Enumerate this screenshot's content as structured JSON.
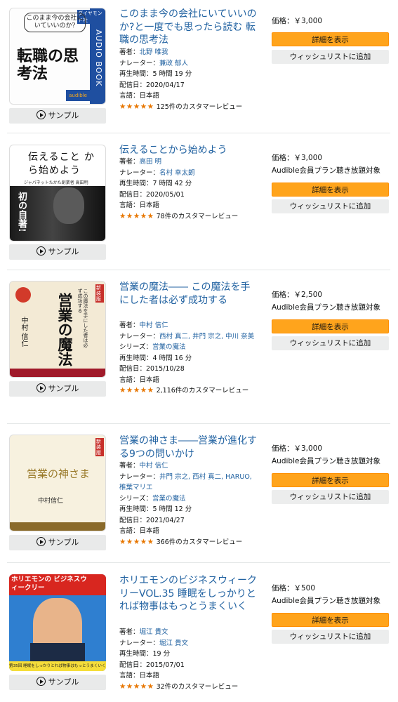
{
  "common": {
    "sample_label": "サンプル",
    "detail_label": "詳細を表示",
    "wishlist_label": "ウィッシュリストに追加",
    "author_prefix": "著者：",
    "narrator_prefix": "ナレーター：",
    "series_prefix": "シリーズ：",
    "runtime_prefix": "再生時間：",
    "release_prefix": "配信日：",
    "language_prefix": "言語：",
    "price_prefix": "価格：",
    "star_glyphs": "★★★★★",
    "star_color": "#e77600",
    "link_color": "#2162a1",
    "button_color": "#ffa41c"
  },
  "items": [
    {
      "title": "このまま今の会社にいていいのか?と一度でも思ったら読む 転職の思考法",
      "author": "北野 唯我",
      "narrator": "兼政 郁人",
      "runtime": "5 時間 19 分",
      "release": "2020/04/17",
      "language": "日本語",
      "rating": 4.5,
      "reviews": "125件のカスタマーレビュー",
      "price": "￥3,000",
      "membership": "",
      "cover": {
        "top_text": "このまま今の会社にいていいのか?",
        "main_text": "転職の思考法",
        "side_text": "AUDIO BOOK",
        "publisher": "ダイヤモンド社",
        "badge": "audible"
      }
    },
    {
      "title": "伝えることから始めよう",
      "author": "高田 明",
      "narrator": "名村 幸太朗",
      "runtime": "7 時間 42 分",
      "release": "2020/05/01",
      "language": "日本語",
      "rating": 4.5,
      "reviews": "78件のカスタマーレビュー",
      "price": "￥3,000",
      "membership": "Audible会員プラン聴き放題対象",
      "cover": {
        "top_text": "伝えること から始めよう",
        "main_text": "初の自著!",
        "sub_text": "ジャパネットたかた創業者 高田明"
      }
    },
    {
      "title": "営業の魔法―― この魔法を手にした者は必ず成功する",
      "author": "中村 信仁",
      "narrator": "西村 真二, 井門 宗之, 中川 奈美",
      "series": "営業の魔法",
      "runtime": "4 時間 16 分",
      "release": "2015/10/28",
      "language": "日本語",
      "rating": 4.5,
      "reviews": "2,116件のカスタマーレビュー",
      "price": "￥2,500",
      "membership": "Audible会員プラン聴き放題対象",
      "cover": {
        "main_text": "営業の魔法",
        "sub_text": "この魔法を手にした者は必ず成功する",
        "badge": "新装版",
        "author": "中村 信仁"
      }
    },
    {
      "title": "営業の神さま――営業が進化する9つの問いかけ",
      "author": "中村 信仁",
      "narrator": "井門 宗之, 西村 真二, HARUO, 椎葉マリエ",
      "series": "営業の魔法",
      "runtime": "5 時間 12 分",
      "release": "2021/04/27",
      "language": "日本語",
      "rating": 4.5,
      "reviews": "366件のカスタマーレビュー",
      "price": "￥3,000",
      "membership": "Audible会員プラン聴き放題対象",
      "cover": {
        "main_text": "営業の神さま",
        "badge": "新装版",
        "author": "中村信仁"
      }
    },
    {
      "title": "ホリエモンのビジネスウィークリーVOL.35 睡眠をしっかりとれば物事はもっとうまくいく",
      "author": "堀江 貴文",
      "narrator": "堀江 貴文",
      "runtime": "19 分",
      "release": "2015/07/01",
      "language": "日本語",
      "rating": 4.5,
      "reviews": "32件のカスタマーレビュー",
      "price": "￥500",
      "membership": "Audible会員プラン聴き放題対象",
      "cover": {
        "top_text": "ホリエモンの ビジネスウィークリー",
        "bottom_text": "第35回 睡眠をしっかりとれば物事はもっとうまくいく"
      }
    }
  ]
}
